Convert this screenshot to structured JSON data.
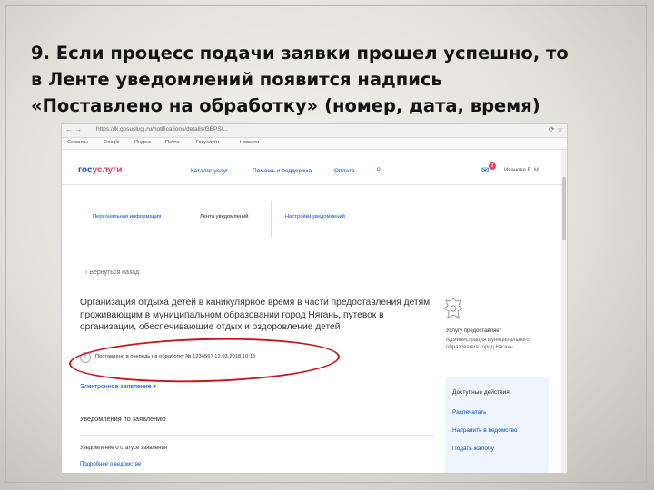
{
  "slide": {
    "heading_line1": "9. Если процесс подачи заявки прошел  успешно, то",
    "heading_line2": "в Ленте уведомлений появится надпись",
    "heading_open_quote": "«",
    "heading_highlight": "Поставлено на обработку",
    "heading_close_quote": "»",
    "heading_tail": " (номер, дата, время)"
  },
  "browser": {
    "url": "https://lk.gosuslugi.ru/notifications/details/GEPS/...",
    "bookmarks": [
      "Сервисы",
      "Google",
      "Яндекс",
      "Почта",
      "Госуслуги",
      "Новости"
    ]
  },
  "site": {
    "logo_main": "гос",
    "logo_accent": "услуги",
    "nav": [
      "Каталог услуг",
      "Помощь и поддержка",
      "Оплата"
    ],
    "user_name": "Иванова Е. М.",
    "mail_count": "3"
  },
  "subnav": {
    "personal": "Персональная информация",
    "feed": "Лента уведомлений",
    "settings": "Настройки уведомлений"
  },
  "back_link": "‹  Вернуться назад",
  "service_title": "Организация отдыха детей в каникулярное время в части предоставления детям, проживающим в муниципальном образовании город Нягань, путевок в организации, обеспечивающие отдых и оздоровление детей",
  "status_text": "Поставлено в очередь на обработку № 1234567  12.03.2018  10:15",
  "links": {
    "electronic": "Электронное заявление ▾",
    "notifications": "Уведомления по заявлению",
    "history": "Уведомление о статусе заявления",
    "more": "Подробнее о ведомстве"
  },
  "provider": {
    "label": "Услугу предоставляет",
    "name": "Администрация муниципального образования город Нягань"
  },
  "actions": {
    "title": "Доступные действия",
    "items": [
      "Распечатать",
      "Направить в ведомство",
      "Подать жалобу"
    ]
  },
  "colors": {
    "brand_blue": "#0d4cd3",
    "brand_red": "#ee3f58",
    "highlight_ellipse": "#c4161c"
  },
  "icons": [
    "back-icon",
    "forward-icon",
    "check-icon",
    "search-icon",
    "mail-icon",
    "emblem-icon"
  ]
}
